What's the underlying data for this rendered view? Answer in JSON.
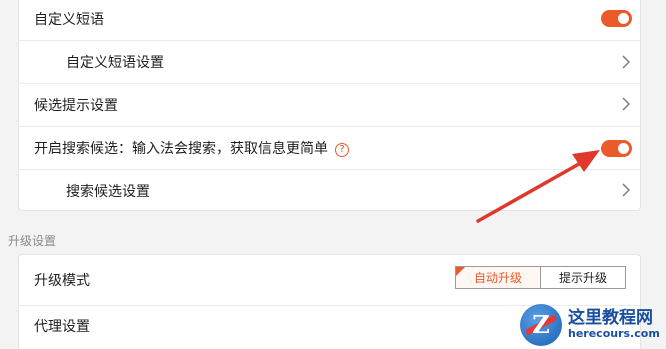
{
  "card1": {
    "rows": [
      {
        "label": "自定义短语",
        "control": "toggle",
        "on": true
      },
      {
        "label": "自定义短语设置",
        "control": "chevron"
      },
      {
        "label": "候选提示设置",
        "control": "chevron"
      },
      {
        "label": "开启搜索候选：输入法会搜索，获取信息更简单",
        "control": "toggle",
        "on": true,
        "help_icon": "?"
      },
      {
        "label": "搜索候选设置",
        "control": "chevron"
      }
    ]
  },
  "upgrade_section": {
    "title": "升级设置",
    "mode_label": "升级模式",
    "mode_options": [
      "自动升级",
      "提示升级"
    ],
    "selected_option": "自动升级",
    "proxy_label": "代理设置"
  },
  "watermark": {
    "logo_letter": "Z",
    "name": "这里教程网",
    "domain": "herecours.com"
  },
  "colors": {
    "accent": "#ea5a2a",
    "arrow": "#e0392b",
    "background": "#f3f3f3",
    "card": "#ffffff"
  },
  "icons": {
    "toggle": "toggle-switch",
    "chevron": "chevron-right-icon",
    "help": "question-circle-icon",
    "arrow": "annotation-arrow"
  }
}
